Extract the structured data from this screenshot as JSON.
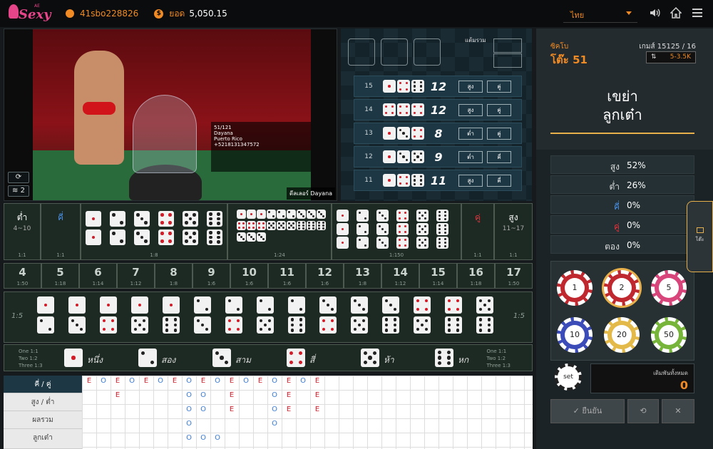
{
  "header": {
    "username": "41sbo228826",
    "balance_label": "ยอด",
    "balance": "5,050.15",
    "language": "ไทย",
    "logo_text": "Sexy",
    "logo_small": "AE"
  },
  "video": {
    "dealer_label": "ดีลเลอร์ Dayana",
    "card_lines": [
      "51/121",
      "Dayana",
      "Puerto Rico",
      "+5218131347572"
    ],
    "refresh_icon": "refresh-icon",
    "signal_count": "2"
  },
  "results": {
    "total_label": "แต้มรวม",
    "history": [
      {
        "round": "15",
        "dice": [
          1,
          4,
          6
        ],
        "sum": "12",
        "tags": [
          "สูง",
          "คู่"
        ]
      },
      {
        "round": "14",
        "dice": [
          4,
          4,
          4
        ],
        "sum": "12",
        "tags": [
          "สูง",
          "คู่"
        ]
      },
      {
        "round": "13",
        "dice": [
          1,
          3,
          4
        ],
        "sum": "8",
        "tags": [
          "ต่ำ",
          "คู่"
        ]
      },
      {
        "round": "12",
        "dice": [
          1,
          3,
          5
        ],
        "sum": "9",
        "tags": [
          "ต่ำ",
          "คี่"
        ]
      },
      {
        "round": "11",
        "dice": [
          1,
          4,
          6
        ],
        "sum": "11",
        "tags": [
          "สูง",
          "คี่"
        ]
      }
    ]
  },
  "panel": {
    "category": "ซิคโบ",
    "table": "โต๊ะ 51",
    "game_no": "เกมส์ 15125 / 16",
    "limit": "5-3.5K",
    "phase_line1": "เขย่า",
    "phase_line2": "ลูกเต๋า",
    "stats": [
      {
        "k": "สูง",
        "v": "52%",
        "c": "#ddd"
      },
      {
        "k": "ต่ำ",
        "v": "26%",
        "c": "#ddd"
      },
      {
        "k": "คี่",
        "v": "0%",
        "c": "#4a8fe0"
      },
      {
        "k": "คู่",
        "v": "0%",
        "c": "#e0323c"
      },
      {
        "k": "ตอง",
        "v": "0%",
        "c": "#ddd"
      }
    ],
    "chips": [
      "1",
      "2",
      "5",
      "10",
      "20",
      "50"
    ],
    "chip_colors": [
      "#c0282f",
      "#c0282f",
      "#d8457a",
      "#3b4bb8",
      "#e3b94a",
      "#76b43a"
    ],
    "set_label": "set",
    "total_bet_label": "เดิมพันทั้งหมด",
    "total_bet": "0",
    "confirm_label": "ยืนยัน",
    "side_tab": "โต๊ะ"
  },
  "board": {
    "low": "ต่ำ",
    "low_range": "4~10",
    "low_odds": "1:1",
    "odd": "คี่",
    "odd_odds": "1:1",
    "double_odds": "1:8",
    "triple_any_odds": "1:24",
    "triple_odds": "1:150",
    "even": "คู่",
    "even_odds": "1:1",
    "high": "สูง",
    "high_range": "11~17",
    "high_odds": "1:1",
    "numbers": [
      {
        "n": "4",
        "o": "1:50"
      },
      {
        "n": "5",
        "o": "1:18"
      },
      {
        "n": "6",
        "o": "1:14"
      },
      {
        "n": "7",
        "o": "1:12"
      },
      {
        "n": "8",
        "o": "1:8"
      },
      {
        "n": "9",
        "o": "1:6"
      },
      {
        "n": "10",
        "o": "1:6"
      },
      {
        "n": "11",
        "o": "1:6"
      },
      {
        "n": "12",
        "o": "1:6"
      },
      {
        "n": "13",
        "o": "1:8"
      },
      {
        "n": "14",
        "o": "1:12"
      },
      {
        "n": "15",
        "o": "1:14"
      },
      {
        "n": "16",
        "o": "1:18"
      },
      {
        "n": "17",
        "o": "1:50"
      }
    ],
    "combo_odds": "1:5",
    "single_odds": [
      "One 1:1",
      "Two 1:2",
      "Three 1:3"
    ],
    "singles": [
      "หนึ่ง",
      "สอง",
      "สาม",
      "สี่",
      "ห้า",
      "หก"
    ]
  },
  "history": {
    "labels": [
      "คี่ / คู่",
      "สูง / ต่ำ",
      "ผลรวม",
      "ลูกเต๋า"
    ],
    "marks": [
      [
        0,
        0,
        "E"
      ],
      [
        1,
        0,
        "O"
      ],
      [
        2,
        0,
        "E"
      ],
      [
        3,
        0,
        "O"
      ],
      [
        4,
        0,
        "E"
      ],
      [
        5,
        0,
        "O"
      ],
      [
        6,
        0,
        "E"
      ],
      [
        7,
        0,
        "O"
      ],
      [
        8,
        0,
        "E"
      ],
      [
        9,
        0,
        "O"
      ],
      [
        10,
        0,
        "E"
      ],
      [
        11,
        0,
        "O"
      ],
      [
        12,
        0,
        "E"
      ],
      [
        13,
        0,
        "O"
      ],
      [
        14,
        0,
        "E"
      ],
      [
        15,
        0,
        "O"
      ],
      [
        16,
        0,
        "E"
      ],
      [
        2,
        1,
        "E"
      ],
      [
        7,
        1,
        "O"
      ],
      [
        8,
        1,
        "O"
      ],
      [
        10,
        1,
        "E"
      ],
      [
        13,
        1,
        "O"
      ],
      [
        14,
        1,
        "E"
      ],
      [
        16,
        1,
        "E"
      ],
      [
        7,
        2,
        "O"
      ],
      [
        8,
        2,
        "O"
      ],
      [
        10,
        2,
        "E"
      ],
      [
        13,
        2,
        "O"
      ],
      [
        14,
        2,
        "E"
      ],
      [
        16,
        2,
        "E"
      ],
      [
        7,
        3,
        "O"
      ],
      [
        13,
        3,
        "O"
      ],
      [
        7,
        4,
        "O"
      ],
      [
        8,
        4,
        "O"
      ],
      [
        9,
        4,
        "O"
      ]
    ]
  }
}
